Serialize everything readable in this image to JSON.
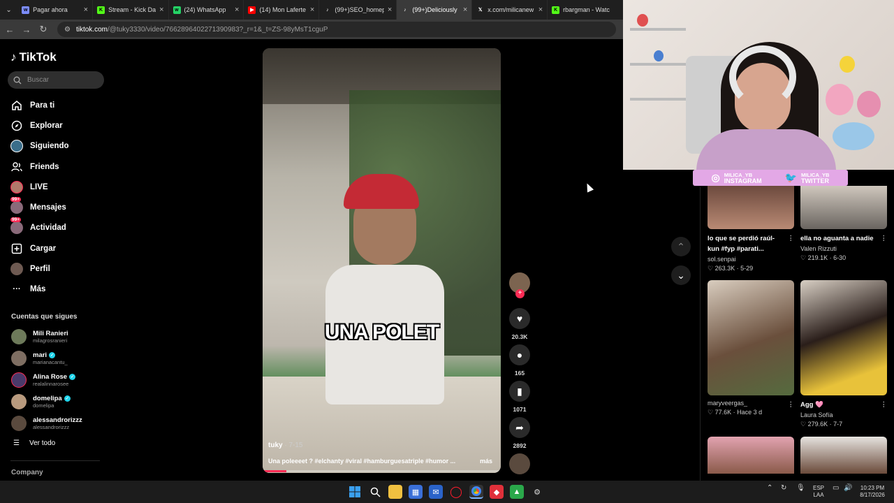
{
  "browser": {
    "tabs": [
      {
        "label": "Pagar ahora",
        "color": "#7b8cff"
      },
      {
        "label": "Stream - Kick Da",
        "color": "#53fc18"
      },
      {
        "label": "(24) WhatsApp",
        "color": "#25d366"
      },
      {
        "label": "(14) Mon Laferte",
        "color": "#ff0000"
      },
      {
        "label": "(99+)SEO_homep",
        "color": "#ffffff"
      },
      {
        "label": "(99+)Deliciously",
        "color": "#ffffff"
      },
      {
        "label": "x.com/milicanew",
        "color": "#ffffff"
      },
      {
        "label": "rbargman - Watc",
        "color": "#53fc18"
      }
    ],
    "url_host": "tiktok.com",
    "url_path": "/@tuky3330/video/7662896402271390983?_r=1&_t=ZS-98yMsT1cguP"
  },
  "sidebar": {
    "logo": "TikTok",
    "search_placeholder": "Buscar",
    "nav": [
      {
        "label": "Para ti",
        "icon": "home-icon"
      },
      {
        "label": "Explorar",
        "icon": "compass-icon"
      },
      {
        "label": "Siguiendo",
        "icon": "following-icon"
      },
      {
        "label": "Friends",
        "icon": "friends-icon"
      },
      {
        "label": "LIVE",
        "icon": "live-icon"
      },
      {
        "label": "Mensajes",
        "icon": "messages-icon",
        "badge": "99+"
      },
      {
        "label": "Actividad",
        "icon": "activity-icon",
        "badge": "99+"
      },
      {
        "label": "Cargar",
        "icon": "upload-icon"
      },
      {
        "label": "Perfil",
        "icon": "profile-icon"
      },
      {
        "label": "Más",
        "icon": "more-icon"
      }
    ],
    "following_title": "Cuentas que sigues",
    "following": [
      {
        "name": "Mili Ranieri",
        "handle": "milagrosranieri",
        "verified": false
      },
      {
        "name": "mari",
        "handle": "marianacantu_",
        "verified": true
      },
      {
        "name": "Alina Rose",
        "handle": "realalinnarosee",
        "verified": true
      },
      {
        "name": "domelipa",
        "handle": "domelipa",
        "verified": true
      },
      {
        "name": "alessandrorizzz",
        "handle": "alessandrorizzz",
        "verified": false
      }
    ],
    "see_all": "Ver todo",
    "company": "Company"
  },
  "video": {
    "overlay_text": "UNA POLET",
    "author": "tuky",
    "date": "7-15",
    "description": "Una poleeeet ? #elchanty #viral #hamburguesatriple #humor ...",
    "more": "más",
    "progress": 0.1,
    "likes": "20.3K",
    "comments": "165",
    "saves": "1071",
    "shares": "2892"
  },
  "stream_overlay": {
    "instagram_handle": "MILICA_YB",
    "instagram_label": "INSTAGRAM",
    "twitter_handle": "MILICA_YB",
    "twitter_label": "TWITTER"
  },
  "recommendations": [
    {
      "title": "lo que se perdió raúl-kun #fyp #parati...",
      "author": "sol.senpai",
      "likes": "263.3K",
      "date": "5-29"
    },
    {
      "title": "ella no aguanta a nadie",
      "author": "Valen Rizzuti",
      "likes": "219.1K",
      "date": "6-30"
    },
    {
      "title": "",
      "author": "maryveergas_",
      "likes": "77.6K",
      "date": "Hace 3 d"
    },
    {
      "title": "Agg 🩷",
      "author": "Laura Sofía",
      "likes": "279.6K",
      "date": "7-7"
    },
    {
      "title": "",
      "author": "",
      "likes": "",
      "date": ""
    },
    {
      "title": "",
      "author": "",
      "likes": "",
      "date": ""
    }
  ],
  "taskbar": {
    "lang": "ESP",
    "region": "LAA",
    "time": "10:23 PM",
    "date": "8/17/2026"
  }
}
